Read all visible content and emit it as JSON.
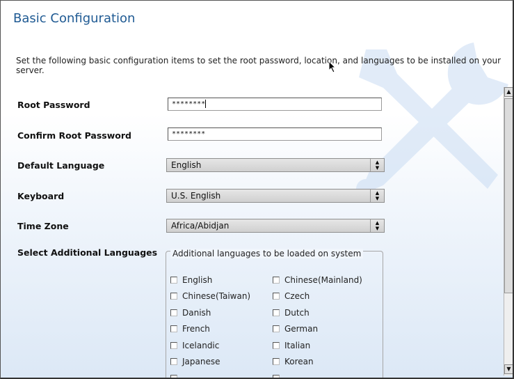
{
  "page": {
    "title": "Basic Configuration",
    "intro": "Set the following basic configuration items to set the root password, location, and languages to be installed on your server."
  },
  "form": {
    "root_password": {
      "label": "Root Password",
      "value": "********"
    },
    "confirm_password": {
      "label": "Confirm Root Password",
      "value": "********"
    },
    "default_language": {
      "label": "Default Language",
      "selected": "English"
    },
    "keyboard": {
      "label": "Keyboard",
      "selected": "U.S. English"
    },
    "time_zone": {
      "label": "Time Zone",
      "selected": "Africa/Abidjan"
    },
    "additional_languages": {
      "label": "Select Additional Languages",
      "legend": "Additional languages to be loaded on system",
      "left": [
        "English",
        "Chinese(Taiwan)",
        "Danish",
        "French",
        "Icelandic",
        "Japanese"
      ],
      "right": [
        "Chinese(Mainland)",
        "Czech",
        "Dutch",
        "German",
        "Italian",
        "Korean"
      ]
    }
  },
  "icons": {
    "select_arrow": "up-down-arrows-icon",
    "scroll_up": "arrow-up-icon",
    "scroll_down": "arrow-down-icon",
    "watermark": "wrench-screwdriver-icon",
    "cursor": "mouse-pointer-icon"
  },
  "colors": {
    "title": "#1f5a93",
    "background_gradient_end": "#dce8f6"
  }
}
